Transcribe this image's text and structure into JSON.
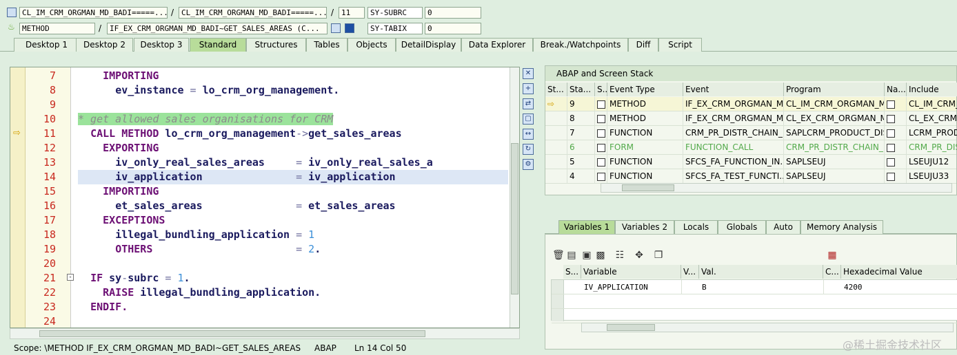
{
  "top_fields": {
    "row1": {
      "class_field": "CL_IM_CRM_ORGMAN_MD_BADI=====...",
      "sep1": "/",
      "class_field2": "CL_IM_CRM_ORGMAN_MD_BADI=====...",
      "sep2": "/",
      "line": "11",
      "label": "SY-SUBRC",
      "value": "0"
    },
    "row2": {
      "type_field": "METHOD",
      "sep1": "/",
      "method_field": "IF_EX_CRM_ORGMAN_MD_BADI~GET_SALES_AREAS (C...",
      "label": "SY-TABIX",
      "value": "0"
    }
  },
  "tabs": [
    "Desktop 1",
    "Desktop 2",
    "Desktop 3",
    "Standard",
    "Structures",
    "Tables",
    "Objects",
    "DetailDisplay",
    "Data Explorer",
    "Break./Watchpoints",
    "Diff",
    "Script"
  ],
  "active_tab": "Standard",
  "editor": {
    "lines": [
      "7",
      "8",
      "9",
      "10",
      "11",
      "12",
      "13",
      "14",
      "15",
      "16",
      "17",
      "18",
      "19",
      "20",
      "21",
      "22",
      "23",
      "24"
    ],
    "code": {
      "l7_kw": "IMPORTING",
      "l8_a": "ev_instance",
      "l8_op": " = ",
      "l8_b": "lo_crm_org_management.",
      "l10_cm": "* get allowed sales organisations for CRM",
      "l11_kw": "CALL METHOD",
      "l11_obj": " lo_crm_org_management",
      "l11_op": "->",
      "l11_m": "get_sales_areas",
      "l12_kw": "EXPORTING",
      "l13_a": "iv_only_real_sales_areas",
      "l13_op": "     = ",
      "l13_b": "iv_only_real_sales_a",
      "l14_a": "iv_application",
      "l14_op": "               = ",
      "l14_b": "iv_application",
      "l15_kw": "IMPORTING",
      "l16_a": "et_sales_areas",
      "l16_op": "               = ",
      "l16_b": "et_sales_areas",
      "l17_kw": "EXCEPTIONS",
      "l18_a": "illegal_bundling_application",
      "l18_op": " = ",
      "l18_n": "1",
      "l19_kw": "OTHERS",
      "l19_op": "                       = ",
      "l19_n": "2",
      "l19_dot": ".",
      "l21_kw": "IF",
      "l21_a": " sy",
      "l21_dash": "-",
      "l21_b": "subrc",
      "l21_op": " = ",
      "l21_n": "1",
      "l21_dot": ".",
      "l22_kw": "RAISE",
      "l22_a": " illegal_bundling_application.",
      "l23_kw": "ENDIF."
    }
  },
  "status": {
    "scope": "Scope: \\METHOD IF_EX_CRM_ORGMAN_MD_BADI~GET_SALES_AREAS",
    "lang": "ABAP",
    "pos": "Ln  14 Col  50"
  },
  "stack": {
    "title": "ABAP and Screen Stack",
    "headers": [
      "St...",
      "Sta...",
      "S...",
      "Event Type",
      "Event",
      "Program",
      "Na...",
      "Include"
    ],
    "rows": [
      {
        "level": "9",
        "type": "METHOD",
        "event": "IF_EX_CRM_ORGMAN_M...",
        "program": "CL_IM_CRM_ORGMAN_M...",
        "include": "CL_IM_CRM_(",
        "current": true,
        "green": false
      },
      {
        "level": "8",
        "type": "METHOD",
        "event": "IF_EX_CRM_ORGMAN_M...",
        "program": "CL_EX_CRM_ORGMAN_M...",
        "include": "CL_EX_CRM_",
        "current": false,
        "green": false
      },
      {
        "level": "7",
        "type": "FUNCTION",
        "event": "CRM_PR_DISTR_CHAIN_...",
        "program": "SAPLCRM_PRODUCT_DIS...",
        "include": "LCRM_PRODU",
        "current": false,
        "green": false
      },
      {
        "level": "6",
        "type": "FORM",
        "event": "FUNCTION_CALL",
        "program": "CRM_PR_DISTR_CHAIN_...",
        "include": "CRM_PR_DIS",
        "current": false,
        "green": true
      },
      {
        "level": "5",
        "type": "FUNCTION",
        "event": "SFCS_FA_FUNCTION_IN...",
        "program": "SAPLSEUJ",
        "include": "LSEUJU12",
        "current": false,
        "green": false
      },
      {
        "level": "4",
        "type": "FUNCTION",
        "event": "SFCS_FA_TEST_FUNCTI...",
        "program": "SAPLSEUJ",
        "include": "LSEUJU33",
        "current": false,
        "green": false
      }
    ]
  },
  "var_tabs": [
    "Variables 1",
    "Variables 2",
    "Locals",
    "Globals",
    "Auto",
    "Memory Analysis"
  ],
  "active_var_tab": "Variables 1",
  "variables": {
    "headers": [
      "S...",
      "Variable",
      "V...",
      "Val.",
      "C...",
      "Hexadecimal Value"
    ],
    "rows": [
      {
        "name": "IV_APPLICATION",
        "value": "B",
        "hex": "4200"
      }
    ]
  },
  "watermark": "@稀土掘金技术社区",
  "colors": {
    "active_tab": "#b8dc9a",
    "keyword": "#6c0f74",
    "number": "#3b8fd8",
    "comment_bg": "#9be39b",
    "line_number": "#c8281e"
  }
}
